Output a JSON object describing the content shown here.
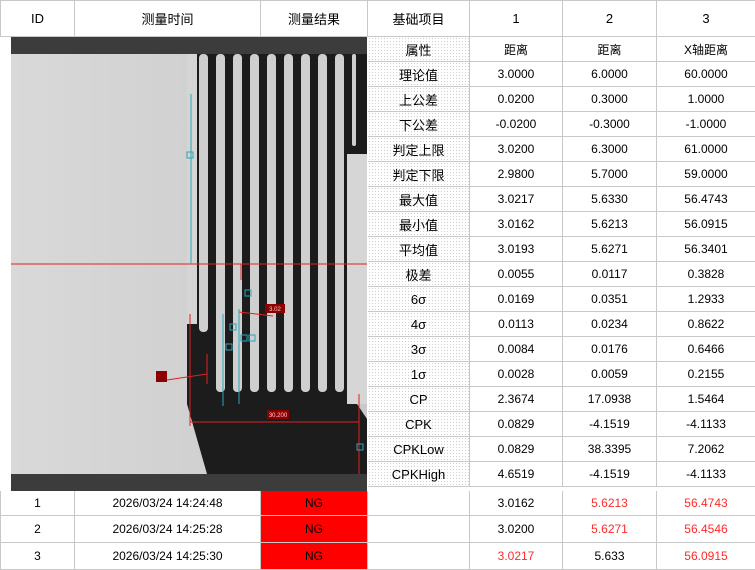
{
  "header": {
    "id": "ID",
    "time": "测量时间",
    "result": "测量结果",
    "items": "基础项目",
    "col1": "1",
    "col2": "2",
    "col3": "3"
  },
  "stats": [
    {
      "label": "属性",
      "v1": "距离",
      "v2": "距离",
      "v3": "X轴距离"
    },
    {
      "label": "理论值",
      "v1": "3.0000",
      "v2": "6.0000",
      "v3": "60.0000"
    },
    {
      "label": "上公差",
      "v1": "0.0200",
      "v2": "0.3000",
      "v3": "1.0000"
    },
    {
      "label": "下公差",
      "v1": "-0.0200",
      "v2": "-0.3000",
      "v3": "-1.0000"
    },
    {
      "label": "判定上限",
      "v1": "3.0200",
      "v2": "6.3000",
      "v3": "61.0000"
    },
    {
      "label": "判定下限",
      "v1": "2.9800",
      "v2": "5.7000",
      "v3": "59.0000"
    },
    {
      "label": "最大值",
      "v1": "3.0217",
      "v2": "5.6330",
      "v3": "56.4743"
    },
    {
      "label": "最小值",
      "v1": "3.0162",
      "v2": "5.6213",
      "v3": "56.0915"
    },
    {
      "label": "平均值",
      "v1": "3.0193",
      "v2": "5.6271",
      "v3": "56.3401"
    },
    {
      "label": "极差",
      "v1": "0.0055",
      "v2": "0.0117",
      "v3": "0.3828"
    },
    {
      "label": "6σ",
      "v1": "0.0169",
      "v2": "0.0351",
      "v3": "1.2933"
    },
    {
      "label": "4σ",
      "v1": "0.0113",
      "v2": "0.0234",
      "v3": "0.8622"
    },
    {
      "label": "3σ",
      "v1": "0.0084",
      "v2": "0.0176",
      "v3": "0.6466"
    },
    {
      "label": "1σ",
      "v1": "0.0028",
      "v2": "0.0059",
      "v3": "0.2155"
    },
    {
      "label": "CP",
      "v1": "2.3674",
      "v2": "17.0938",
      "v3": "1.5464"
    },
    {
      "label": "CPK",
      "v1": "0.0829",
      "v2": "-4.1519",
      "v3": "-4.1133"
    },
    {
      "label": "CPKLow",
      "v1": "0.0829",
      "v2": "38.3395",
      "v3": "7.2062"
    },
    {
      "label": "CPKHigh",
      "v1": "4.6519",
      "v2": "-4.1519",
      "v3": "-4.1133"
    }
  ],
  "records": [
    {
      "id": "1",
      "time": "2026/03/24 14:24:48",
      "result": "NG",
      "v1": "3.0162",
      "v2": "5.6213",
      "v3": "56.4743",
      "red1": false,
      "red2": true,
      "red3": true
    },
    {
      "id": "2",
      "time": "2026/03/24 14:25:28",
      "result": "NG",
      "v1": "3.0200",
      "v2": "5.6271",
      "v3": "56.4546",
      "red1": false,
      "red2": true,
      "red3": true
    },
    {
      "id": "3",
      "time": "2026/03/24 14:25:30",
      "result": "NG",
      "v1": "3.0217",
      "v2": "5.633",
      "v3": "56.0915",
      "red1": true,
      "red2": false,
      "red3": true
    }
  ],
  "overlay": {
    "label_dim": "30.200",
    "label_small": "3.02"
  },
  "colors": {
    "ng": "#ff0000",
    "out_of_tol": "#ff2a2a",
    "overlay_line": "#e02020",
    "marker": "#2aa7b8"
  }
}
